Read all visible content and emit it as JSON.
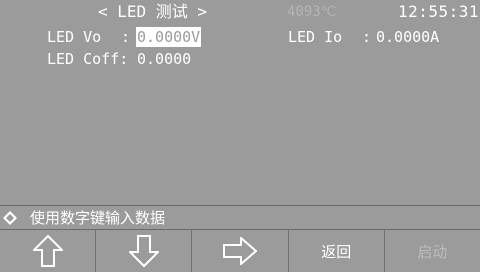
{
  "header": {
    "title": "< LED 测试 >",
    "temperature": "4093℃",
    "clock": "12:55:31"
  },
  "params": {
    "vo": {
      "label": "LED Vo",
      "sep": ":",
      "value": "0.0000V"
    },
    "io": {
      "label": "LED Io",
      "sep": ":",
      "value": "0.0000A"
    },
    "coff": {
      "label": "LED Coff:",
      "value": "0.0000"
    }
  },
  "hint": {
    "icon": "diamond-icon",
    "text": "使用数字键输入数据"
  },
  "softkeys": [
    {
      "icon": "arrow-up-icon",
      "label": ""
    },
    {
      "icon": "arrow-down-icon",
      "label": ""
    },
    {
      "icon": "arrow-right-icon",
      "label": ""
    },
    {
      "icon": "",
      "label": "返回"
    },
    {
      "icon": "",
      "label": "启动"
    }
  ],
  "colors": {
    "background": "#9b9b9b",
    "text": "#ffffff",
    "temperature_text": "#b4b4b4",
    "disabled_text": "#bdbdbd"
  }
}
